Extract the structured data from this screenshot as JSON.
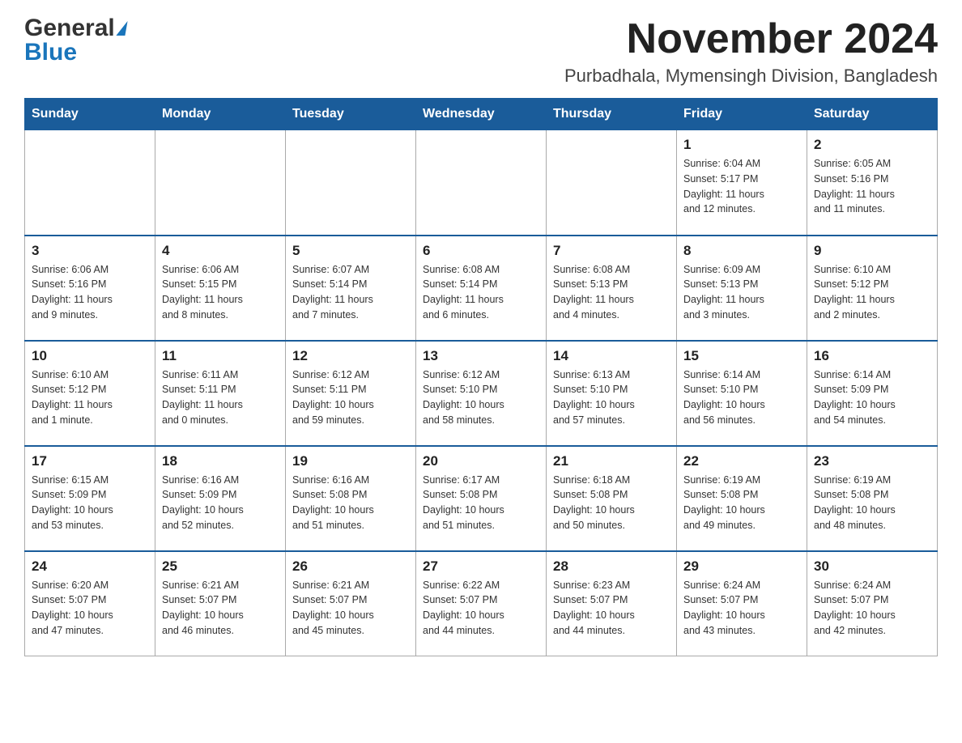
{
  "header": {
    "logo_general": "General",
    "logo_blue": "Blue",
    "title": "November 2024",
    "subtitle": "Purbadhala, Mymensingh Division, Bangladesh"
  },
  "weekdays": [
    "Sunday",
    "Monday",
    "Tuesday",
    "Wednesday",
    "Thursday",
    "Friday",
    "Saturday"
  ],
  "weeks": [
    [
      {
        "day": "",
        "info": ""
      },
      {
        "day": "",
        "info": ""
      },
      {
        "day": "",
        "info": ""
      },
      {
        "day": "",
        "info": ""
      },
      {
        "day": "",
        "info": ""
      },
      {
        "day": "1",
        "info": "Sunrise: 6:04 AM\nSunset: 5:17 PM\nDaylight: 11 hours\nand 12 minutes."
      },
      {
        "day": "2",
        "info": "Sunrise: 6:05 AM\nSunset: 5:16 PM\nDaylight: 11 hours\nand 11 minutes."
      }
    ],
    [
      {
        "day": "3",
        "info": "Sunrise: 6:06 AM\nSunset: 5:16 PM\nDaylight: 11 hours\nand 9 minutes."
      },
      {
        "day": "4",
        "info": "Sunrise: 6:06 AM\nSunset: 5:15 PM\nDaylight: 11 hours\nand 8 minutes."
      },
      {
        "day": "5",
        "info": "Sunrise: 6:07 AM\nSunset: 5:14 PM\nDaylight: 11 hours\nand 7 minutes."
      },
      {
        "day": "6",
        "info": "Sunrise: 6:08 AM\nSunset: 5:14 PM\nDaylight: 11 hours\nand 6 minutes."
      },
      {
        "day": "7",
        "info": "Sunrise: 6:08 AM\nSunset: 5:13 PM\nDaylight: 11 hours\nand 4 minutes."
      },
      {
        "day": "8",
        "info": "Sunrise: 6:09 AM\nSunset: 5:13 PM\nDaylight: 11 hours\nand 3 minutes."
      },
      {
        "day": "9",
        "info": "Sunrise: 6:10 AM\nSunset: 5:12 PM\nDaylight: 11 hours\nand 2 minutes."
      }
    ],
    [
      {
        "day": "10",
        "info": "Sunrise: 6:10 AM\nSunset: 5:12 PM\nDaylight: 11 hours\nand 1 minute."
      },
      {
        "day": "11",
        "info": "Sunrise: 6:11 AM\nSunset: 5:11 PM\nDaylight: 11 hours\nand 0 minutes."
      },
      {
        "day": "12",
        "info": "Sunrise: 6:12 AM\nSunset: 5:11 PM\nDaylight: 10 hours\nand 59 minutes."
      },
      {
        "day": "13",
        "info": "Sunrise: 6:12 AM\nSunset: 5:10 PM\nDaylight: 10 hours\nand 58 minutes."
      },
      {
        "day": "14",
        "info": "Sunrise: 6:13 AM\nSunset: 5:10 PM\nDaylight: 10 hours\nand 57 minutes."
      },
      {
        "day": "15",
        "info": "Sunrise: 6:14 AM\nSunset: 5:10 PM\nDaylight: 10 hours\nand 56 minutes."
      },
      {
        "day": "16",
        "info": "Sunrise: 6:14 AM\nSunset: 5:09 PM\nDaylight: 10 hours\nand 54 minutes."
      }
    ],
    [
      {
        "day": "17",
        "info": "Sunrise: 6:15 AM\nSunset: 5:09 PM\nDaylight: 10 hours\nand 53 minutes."
      },
      {
        "day": "18",
        "info": "Sunrise: 6:16 AM\nSunset: 5:09 PM\nDaylight: 10 hours\nand 52 minutes."
      },
      {
        "day": "19",
        "info": "Sunrise: 6:16 AM\nSunset: 5:08 PM\nDaylight: 10 hours\nand 51 minutes."
      },
      {
        "day": "20",
        "info": "Sunrise: 6:17 AM\nSunset: 5:08 PM\nDaylight: 10 hours\nand 51 minutes."
      },
      {
        "day": "21",
        "info": "Sunrise: 6:18 AM\nSunset: 5:08 PM\nDaylight: 10 hours\nand 50 minutes."
      },
      {
        "day": "22",
        "info": "Sunrise: 6:19 AM\nSunset: 5:08 PM\nDaylight: 10 hours\nand 49 minutes."
      },
      {
        "day": "23",
        "info": "Sunrise: 6:19 AM\nSunset: 5:08 PM\nDaylight: 10 hours\nand 48 minutes."
      }
    ],
    [
      {
        "day": "24",
        "info": "Sunrise: 6:20 AM\nSunset: 5:07 PM\nDaylight: 10 hours\nand 47 minutes."
      },
      {
        "day": "25",
        "info": "Sunrise: 6:21 AM\nSunset: 5:07 PM\nDaylight: 10 hours\nand 46 minutes."
      },
      {
        "day": "26",
        "info": "Sunrise: 6:21 AM\nSunset: 5:07 PM\nDaylight: 10 hours\nand 45 minutes."
      },
      {
        "day": "27",
        "info": "Sunrise: 6:22 AM\nSunset: 5:07 PM\nDaylight: 10 hours\nand 44 minutes."
      },
      {
        "day": "28",
        "info": "Sunrise: 6:23 AM\nSunset: 5:07 PM\nDaylight: 10 hours\nand 44 minutes."
      },
      {
        "day": "29",
        "info": "Sunrise: 6:24 AM\nSunset: 5:07 PM\nDaylight: 10 hours\nand 43 minutes."
      },
      {
        "day": "30",
        "info": "Sunrise: 6:24 AM\nSunset: 5:07 PM\nDaylight: 10 hours\nand 42 minutes."
      }
    ]
  ]
}
